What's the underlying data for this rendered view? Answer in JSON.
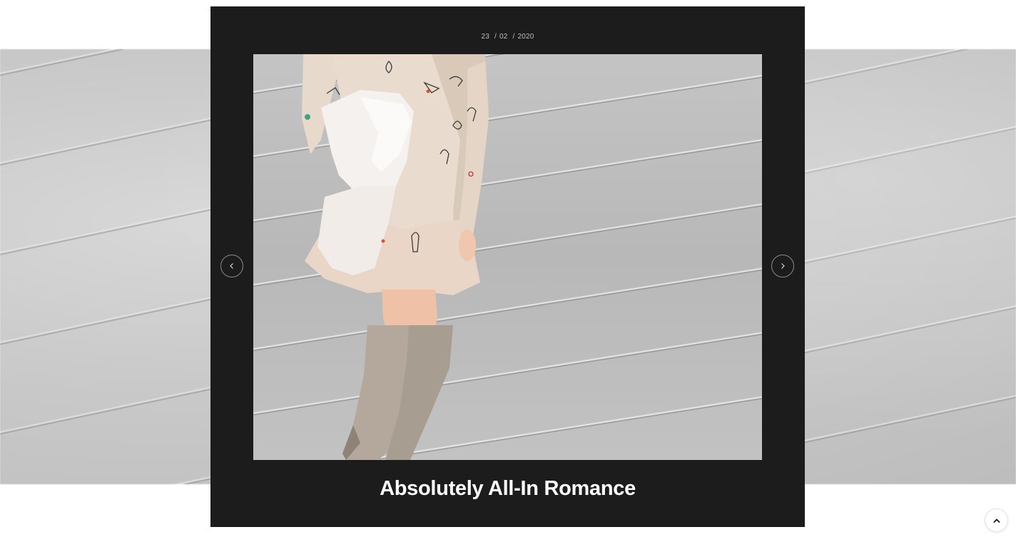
{
  "post": {
    "date_day": "23",
    "date_sep": "/",
    "date_month": "02",
    "date_year": "2020",
    "title": "Absolutely All-In Romance",
    "image_alt": "Woman in embroidered cream dress and over-the-knee suede boots against a grey wall"
  },
  "gallery": {
    "prev_icon": "chevron-left-icon",
    "next_icon": "chevron-right-icon"
  },
  "scroll_top": {
    "icon": "chevron-up-icon"
  },
  "colors": {
    "card_bg": "#1c1c1c",
    "title": "#ffffff",
    "date": "#bdbdbd"
  }
}
